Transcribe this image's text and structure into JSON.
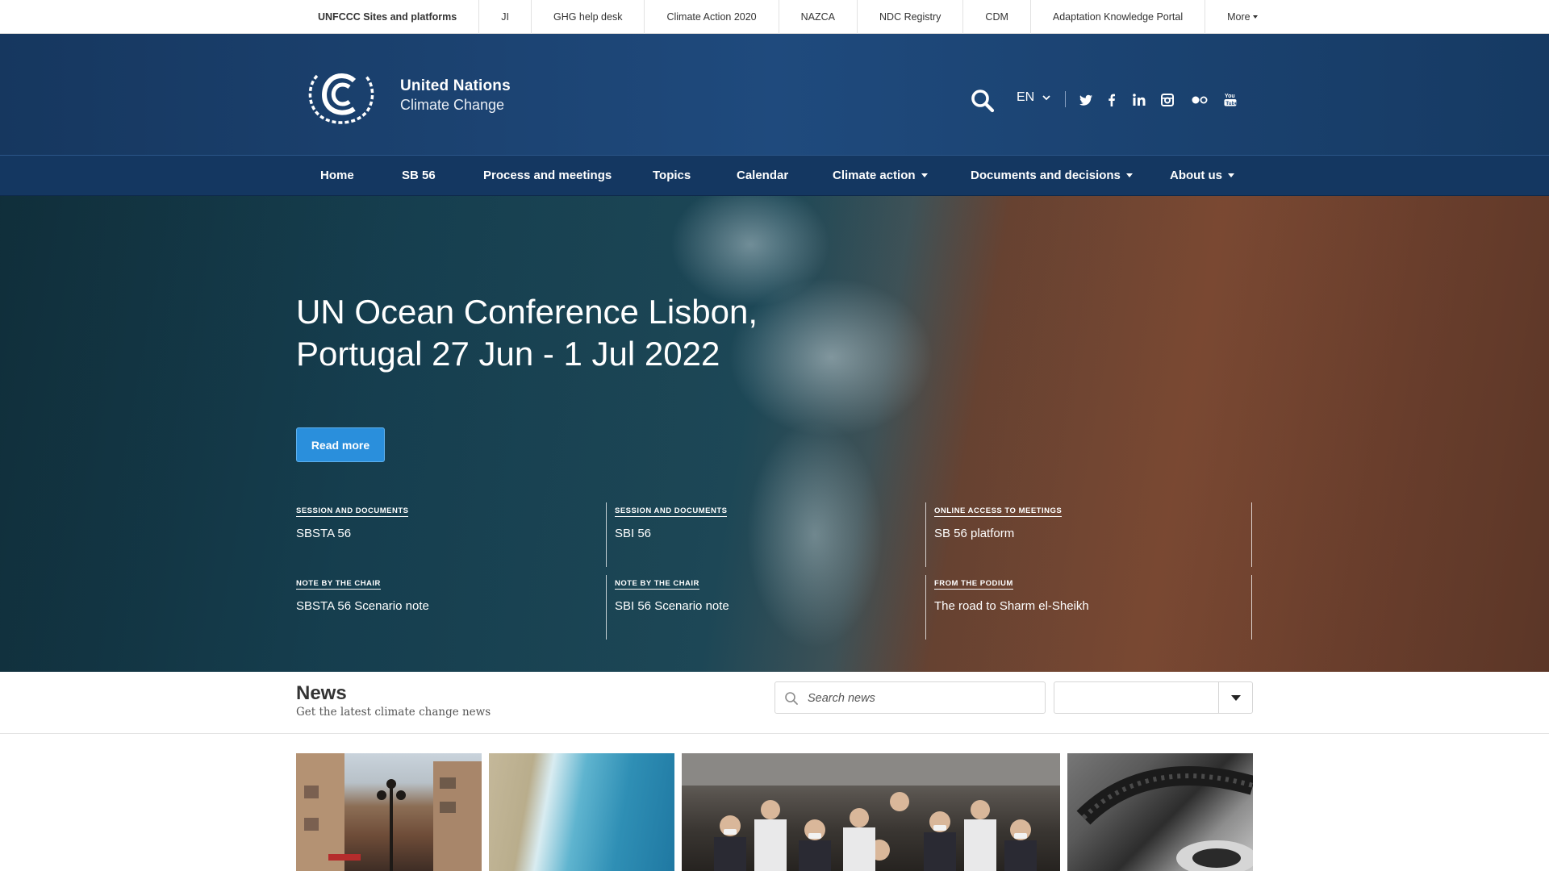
{
  "topbar": {
    "items": [
      "UNFCCC Sites and platforms",
      "JI",
      "GHG help desk",
      "Climate Action 2020",
      "NAZCA",
      "NDC Registry",
      "CDM",
      "Adaptation Knowledge Portal",
      "More"
    ]
  },
  "header": {
    "brand_line1": "United Nations",
    "brand_line2": "Climate Change",
    "language": "EN",
    "social_icons": [
      "twitter-icon",
      "facebook-icon",
      "linkedin-icon",
      "instagram-icon",
      "flickr-icon",
      "youtube-icon"
    ]
  },
  "nav": {
    "items": [
      {
        "label": "Home",
        "dropdown": false
      },
      {
        "label": "SB 56",
        "dropdown": false
      },
      {
        "label": "Process and meetings",
        "dropdown": false
      },
      {
        "label": "Topics",
        "dropdown": false
      },
      {
        "label": "Calendar",
        "dropdown": false
      },
      {
        "label": "Climate action",
        "dropdown": true
      },
      {
        "label": "Documents and decisions",
        "dropdown": true
      },
      {
        "label": "About us",
        "dropdown": true
      }
    ]
  },
  "hero": {
    "title_line1": "UN Ocean Conference Lisbon,",
    "title_line2": "Portugal 27 Jun - 1 Jul 2022",
    "button_label": "Read more",
    "cards": [
      {
        "category": "Session and documents",
        "title": "SBSTA 56"
      },
      {
        "category": "Session and documents",
        "title": "SBI 56"
      },
      {
        "category": "Online access to meetings",
        "title": "SB 56 platform"
      },
      {
        "category": "Note by the chair",
        "title": "SBSTA 56 Scenario note"
      },
      {
        "category": "Note by the chair",
        "title": "SBI 56 Scenario note"
      },
      {
        "category": "From the podium",
        "title": "The road to Sharm el-Sheikh"
      }
    ]
  },
  "news": {
    "title": "News",
    "subtitle": "Get the latest climate change news",
    "search_placeholder": "Search news",
    "filter_value": ""
  },
  "colors": {
    "header_blue": "#1f4a7d",
    "nav_blue": "#143761",
    "button_blue": "#2a8fdc"
  }
}
